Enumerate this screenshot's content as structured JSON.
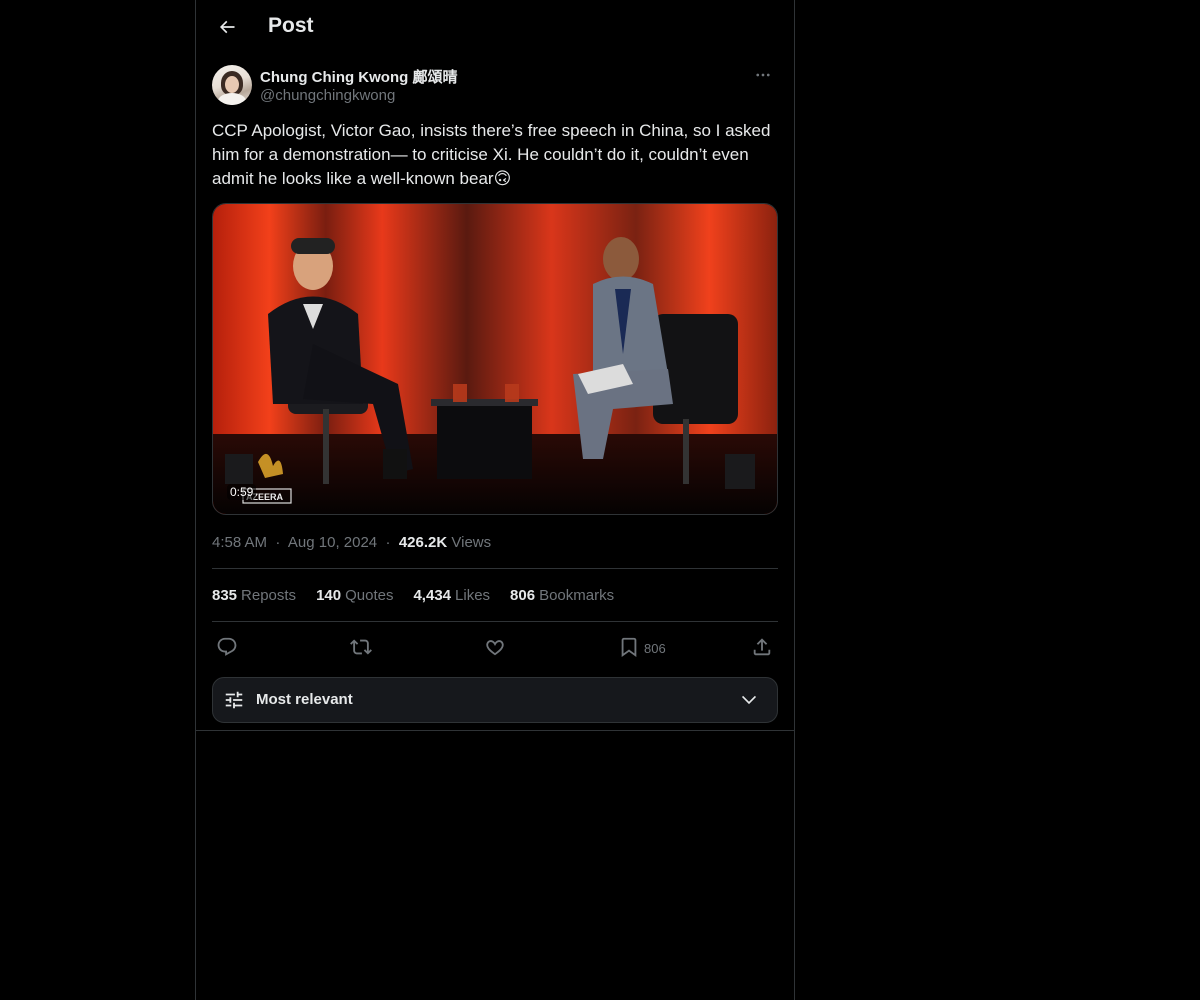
{
  "header": {
    "title": "Post",
    "back_icon": "arrow-left-icon"
  },
  "author": {
    "name": "Chung Ching Kwong 鄺頌晴",
    "handle": "@chungchingkwong",
    "more_icon": "more-horizontal-icon"
  },
  "post": {
    "text": "CCP Apologist, Victor Gao, insists there’s free speech in China, so I asked him for a demonstration— to criticise Xi. He couldn’t do it, couldn’t even admit he looks like a well-known bear🙃"
  },
  "media": {
    "type": "video",
    "duration": "0:59",
    "watermark": "AZEERA"
  },
  "meta": {
    "time": "4:58 AM",
    "separator": "·",
    "date": "Aug 10, 2024",
    "views_count": "426.2K",
    "views_label": "Views"
  },
  "stats": [
    {
      "count": "835",
      "label": "Reposts"
    },
    {
      "count": "140",
      "label": "Quotes"
    },
    {
      "count": "4,434",
      "label": "Likes"
    },
    {
      "count": "806",
      "label": "Bookmarks"
    }
  ],
  "actions": {
    "reply_icon": "reply-icon",
    "repost_icon": "repost-icon",
    "like_icon": "heart-icon",
    "bookmark_icon": "bookmark-icon",
    "bookmark_count": "806",
    "share_icon": "share-icon"
  },
  "replies_sort": {
    "label": "Most relevant",
    "icon": "tune-icon",
    "chevron": "chevron-down-icon"
  },
  "colors": {
    "background": "#000000",
    "text_primary": "#e7e9ea",
    "text_secondary": "#71767b",
    "border": "#2f3336"
  }
}
